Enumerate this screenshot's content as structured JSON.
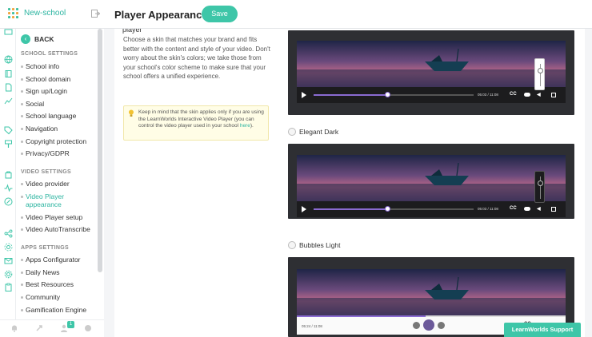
{
  "app": {
    "name": "New-school",
    "page_title": "Player Appearance",
    "save_label": "Save"
  },
  "nav": {
    "back_label": "BACK",
    "sections": [
      {
        "title": "SCHOOL SETTINGS",
        "items": [
          "School info",
          "School domain",
          "Sign up/Login",
          "Social",
          "School language",
          "Navigation",
          "Copyright protection",
          "Privacy/GDPR"
        ]
      },
      {
        "title": "VIDEO SETTINGS",
        "items": [
          "Video provider",
          "Video Player appearance",
          "Video Player setup",
          "Video AutoTranscribe"
        ]
      },
      {
        "title": "APPS SETTINGS",
        "items": [
          "Apps Configurator",
          "Daily News",
          "Best Resources",
          "Community",
          "Gamification Engine"
        ]
      }
    ],
    "active_item": "Video Player appearance"
  },
  "footer": {
    "notification_count": "1"
  },
  "content": {
    "partial_heading": "player",
    "description": "Choose a skin that matches your brand and fits better with the content and style of your video. Don't worry about the skin's colors; we take those from your school's color scheme to make sure that your school offers a unified experience.",
    "notice_text": "Keep in mind that the skin applies only if you are using the LearnWorlds Interactive Video Player (you can control the video player used in your school ",
    "notice_link": "here",
    "notice_end": ")."
  },
  "skins": [
    {
      "label": "",
      "time": "05:03 / 11:08",
      "progress": 0.46,
      "controls_theme": "dark"
    },
    {
      "label": "Elegant Dark",
      "time": "05:03 / 11:08",
      "progress": 0.46,
      "controls_theme": "dark"
    },
    {
      "label": "Bubbles Light",
      "time": "05:24 / 11:08",
      "progress": 0.48,
      "controls_theme": "light"
    }
  ],
  "player_icons": {
    "cc": "CC",
    "toggle": "toggle-icon",
    "volume": "volume-icon",
    "fullscreen": "fullscreen-icon"
  },
  "support": {
    "label": "LearnWorlds Support"
  },
  "colors": {
    "accent": "#3ec6a8",
    "progress": "#8a6bd2",
    "player_bg": "#2e2f33"
  }
}
